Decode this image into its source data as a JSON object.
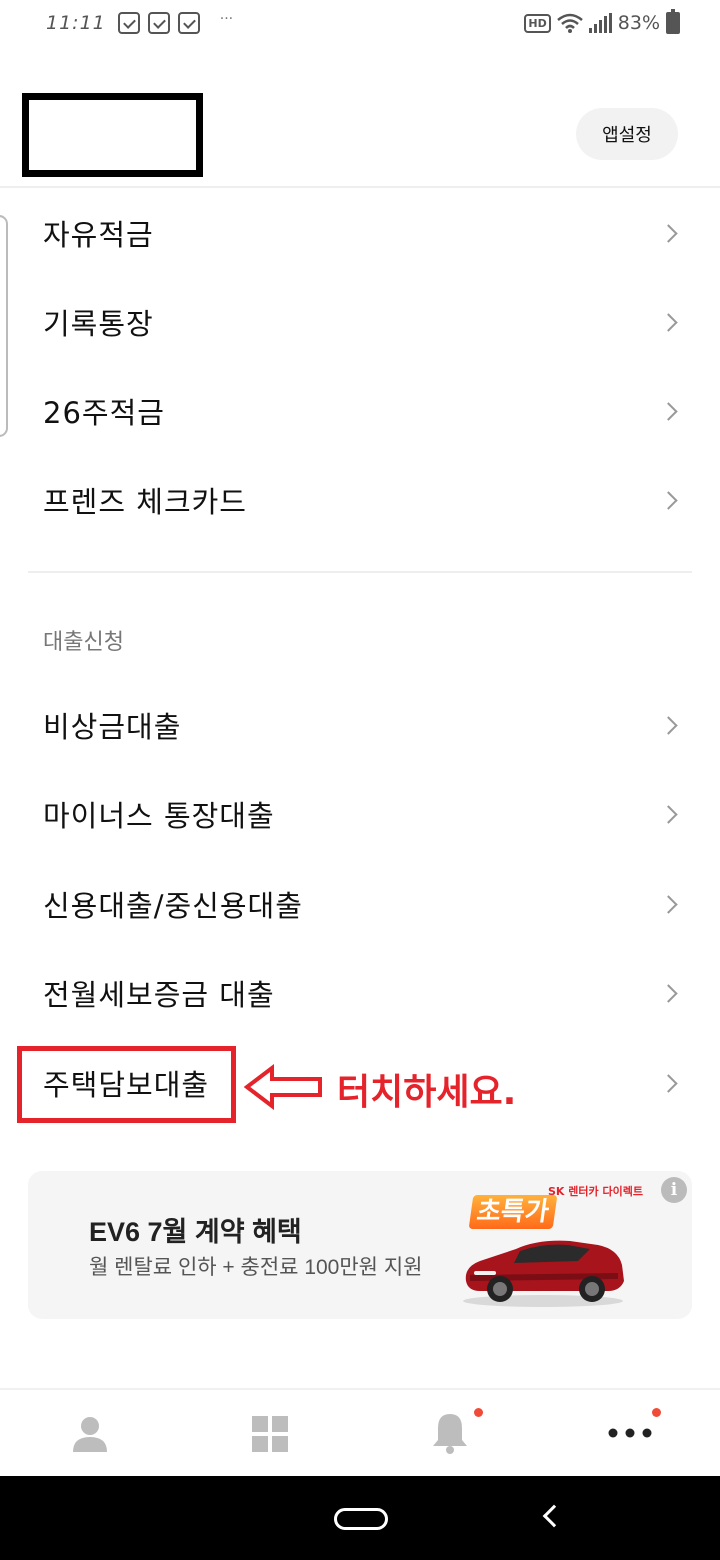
{
  "status_bar": {
    "time": "11:11",
    "battery": "83%",
    "more": "···"
  },
  "header": {
    "app_settings_label": "앱설정"
  },
  "menu_savings": [
    {
      "label": "자유적금"
    },
    {
      "label": "기록통장"
    },
    {
      "label": "26주적금"
    },
    {
      "label": "프렌즈 체크카드"
    }
  ],
  "loan_section": {
    "title": "대출신청",
    "items": [
      {
        "label": "비상금대출"
      },
      {
        "label": "마이너스 통장대출"
      },
      {
        "label": "신용대출/중신용대출"
      },
      {
        "label": "전월세보증금 대출"
      },
      {
        "label": "주택담보대출"
      }
    ]
  },
  "annotation": {
    "text": "터치하세요.",
    "color": "#e4232b"
  },
  "banner": {
    "title": "EV6 7월 계약 혜택",
    "subtitle": "월 렌탈료 인하 + 충전료 100만원 지원",
    "tag": "초특가",
    "brand": "SK 렌터카 다이렉트",
    "info_icon": "info-icon"
  },
  "bottom_nav": {
    "items": [
      "person-icon",
      "grid-icon",
      "bell-icon",
      "more-icon"
    ],
    "badge_color": "#f04b38"
  }
}
